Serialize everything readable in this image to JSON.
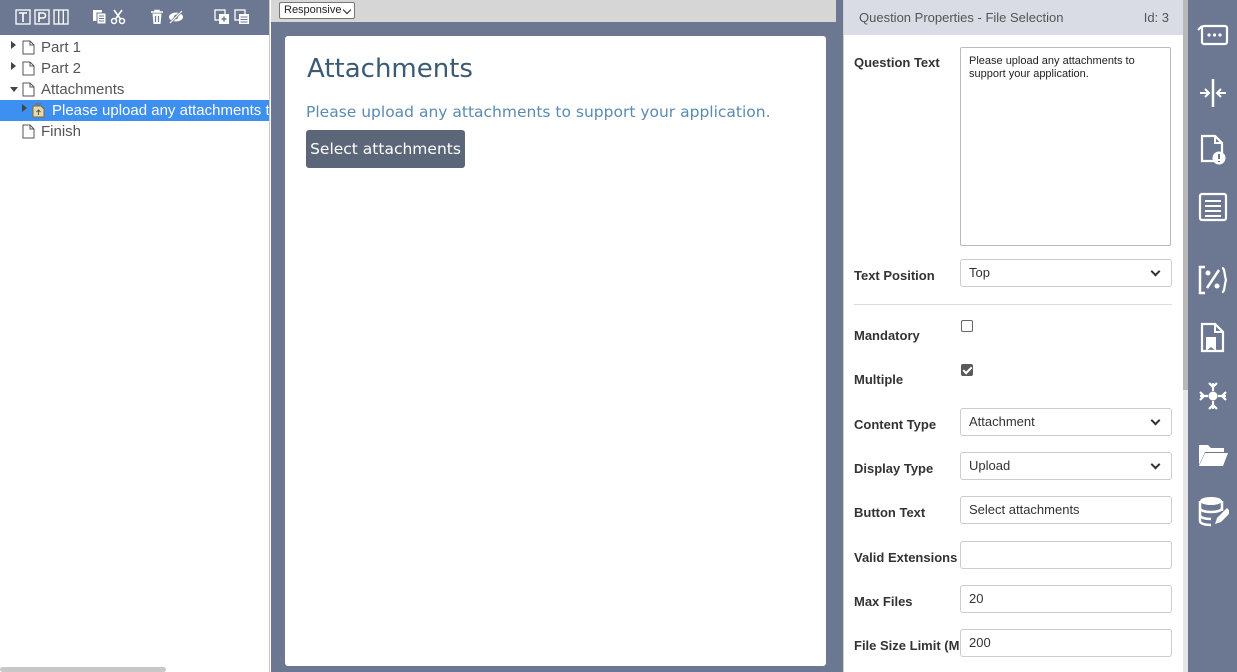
{
  "tree": {
    "items": [
      {
        "label": "Part 1"
      },
      {
        "label": "Part 2"
      },
      {
        "label": "Attachments"
      },
      {
        "label": "Please upload any attachments to"
      },
      {
        "label": "Finish"
      }
    ]
  },
  "preview": {
    "view_mode": "Responsive",
    "page_title": "Attachments",
    "question_text": "Please upload any attachments to support your application.",
    "button_label": "Select attachments"
  },
  "props": {
    "title": "Question Properties - File Selection",
    "id_label": "Id: 3",
    "question_text_label": "Question Text",
    "question_text_value": "Please upload any attachments to support your application.",
    "text_position_label": "Text Position",
    "text_position_value": "Top",
    "mandatory_label": "Mandatory",
    "mandatory_checked": false,
    "multiple_label": "Multiple",
    "multiple_checked": true,
    "content_type_label": "Content Type",
    "content_type_value": "Attachment",
    "display_type_label": "Display Type",
    "display_type_value": "Upload",
    "button_text_label": "Button Text",
    "button_text_value": "Select attachments",
    "valid_extensions_label": "Valid Extensions",
    "valid_extensions_value": "",
    "max_files_label": "Max Files",
    "max_files_value": "20",
    "file_size_label": "File Size Limit (MB)",
    "file_size_value": "200"
  },
  "colors": {
    "toolbar_bg": "#6c7791",
    "selection": "#3d8ff0",
    "title": "#3c5a73",
    "question": "#5a8bb0",
    "button": "#5c6679"
  },
  "icons": {
    "toolbar": [
      "text-icon",
      "paragraph-icon",
      "columns-icon",
      "copy-icon",
      "cut-icon",
      "delete-icon",
      "hide-icon",
      "add-page-icon",
      "add-section-icon"
    ],
    "sidebar": [
      "comment-icon",
      "split-icon",
      "page-warning-icon",
      "list-icon",
      "variable-icon",
      "bookmark-icon",
      "network-icon",
      "folder-icon",
      "database-icon"
    ]
  }
}
